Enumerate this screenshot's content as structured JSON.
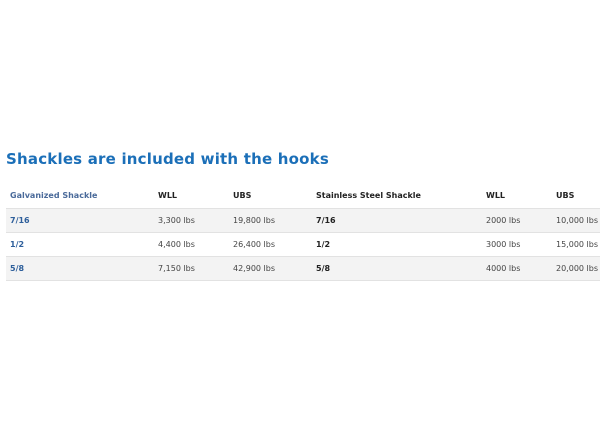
{
  "heading": "Shackles are included with the hooks",
  "table": {
    "headers": [
      "Galvanized Shackle",
      "WLL",
      "UBS",
      "Stainless Steel Shackle",
      "WLL",
      "UBS"
    ],
    "rows": [
      [
        "7/16",
        "3,300 lbs",
        "19,800 lbs",
        "7/16",
        "2000 lbs",
        "10,000 lbs"
      ],
      [
        "1/2",
        "4,400 lbs",
        "26,400 lbs",
        "1/2",
        "3000 lbs",
        "15,000 lbs"
      ],
      [
        "5/8",
        "7,150 lbs",
        "42,900 lbs",
        "5/8",
        "4000 lbs",
        "20,000 lbs"
      ]
    ]
  },
  "colors": {
    "heading": "#1b6fb8",
    "galvanized_link": "#2e5f9b",
    "stripe": "#f3f3f3"
  }
}
